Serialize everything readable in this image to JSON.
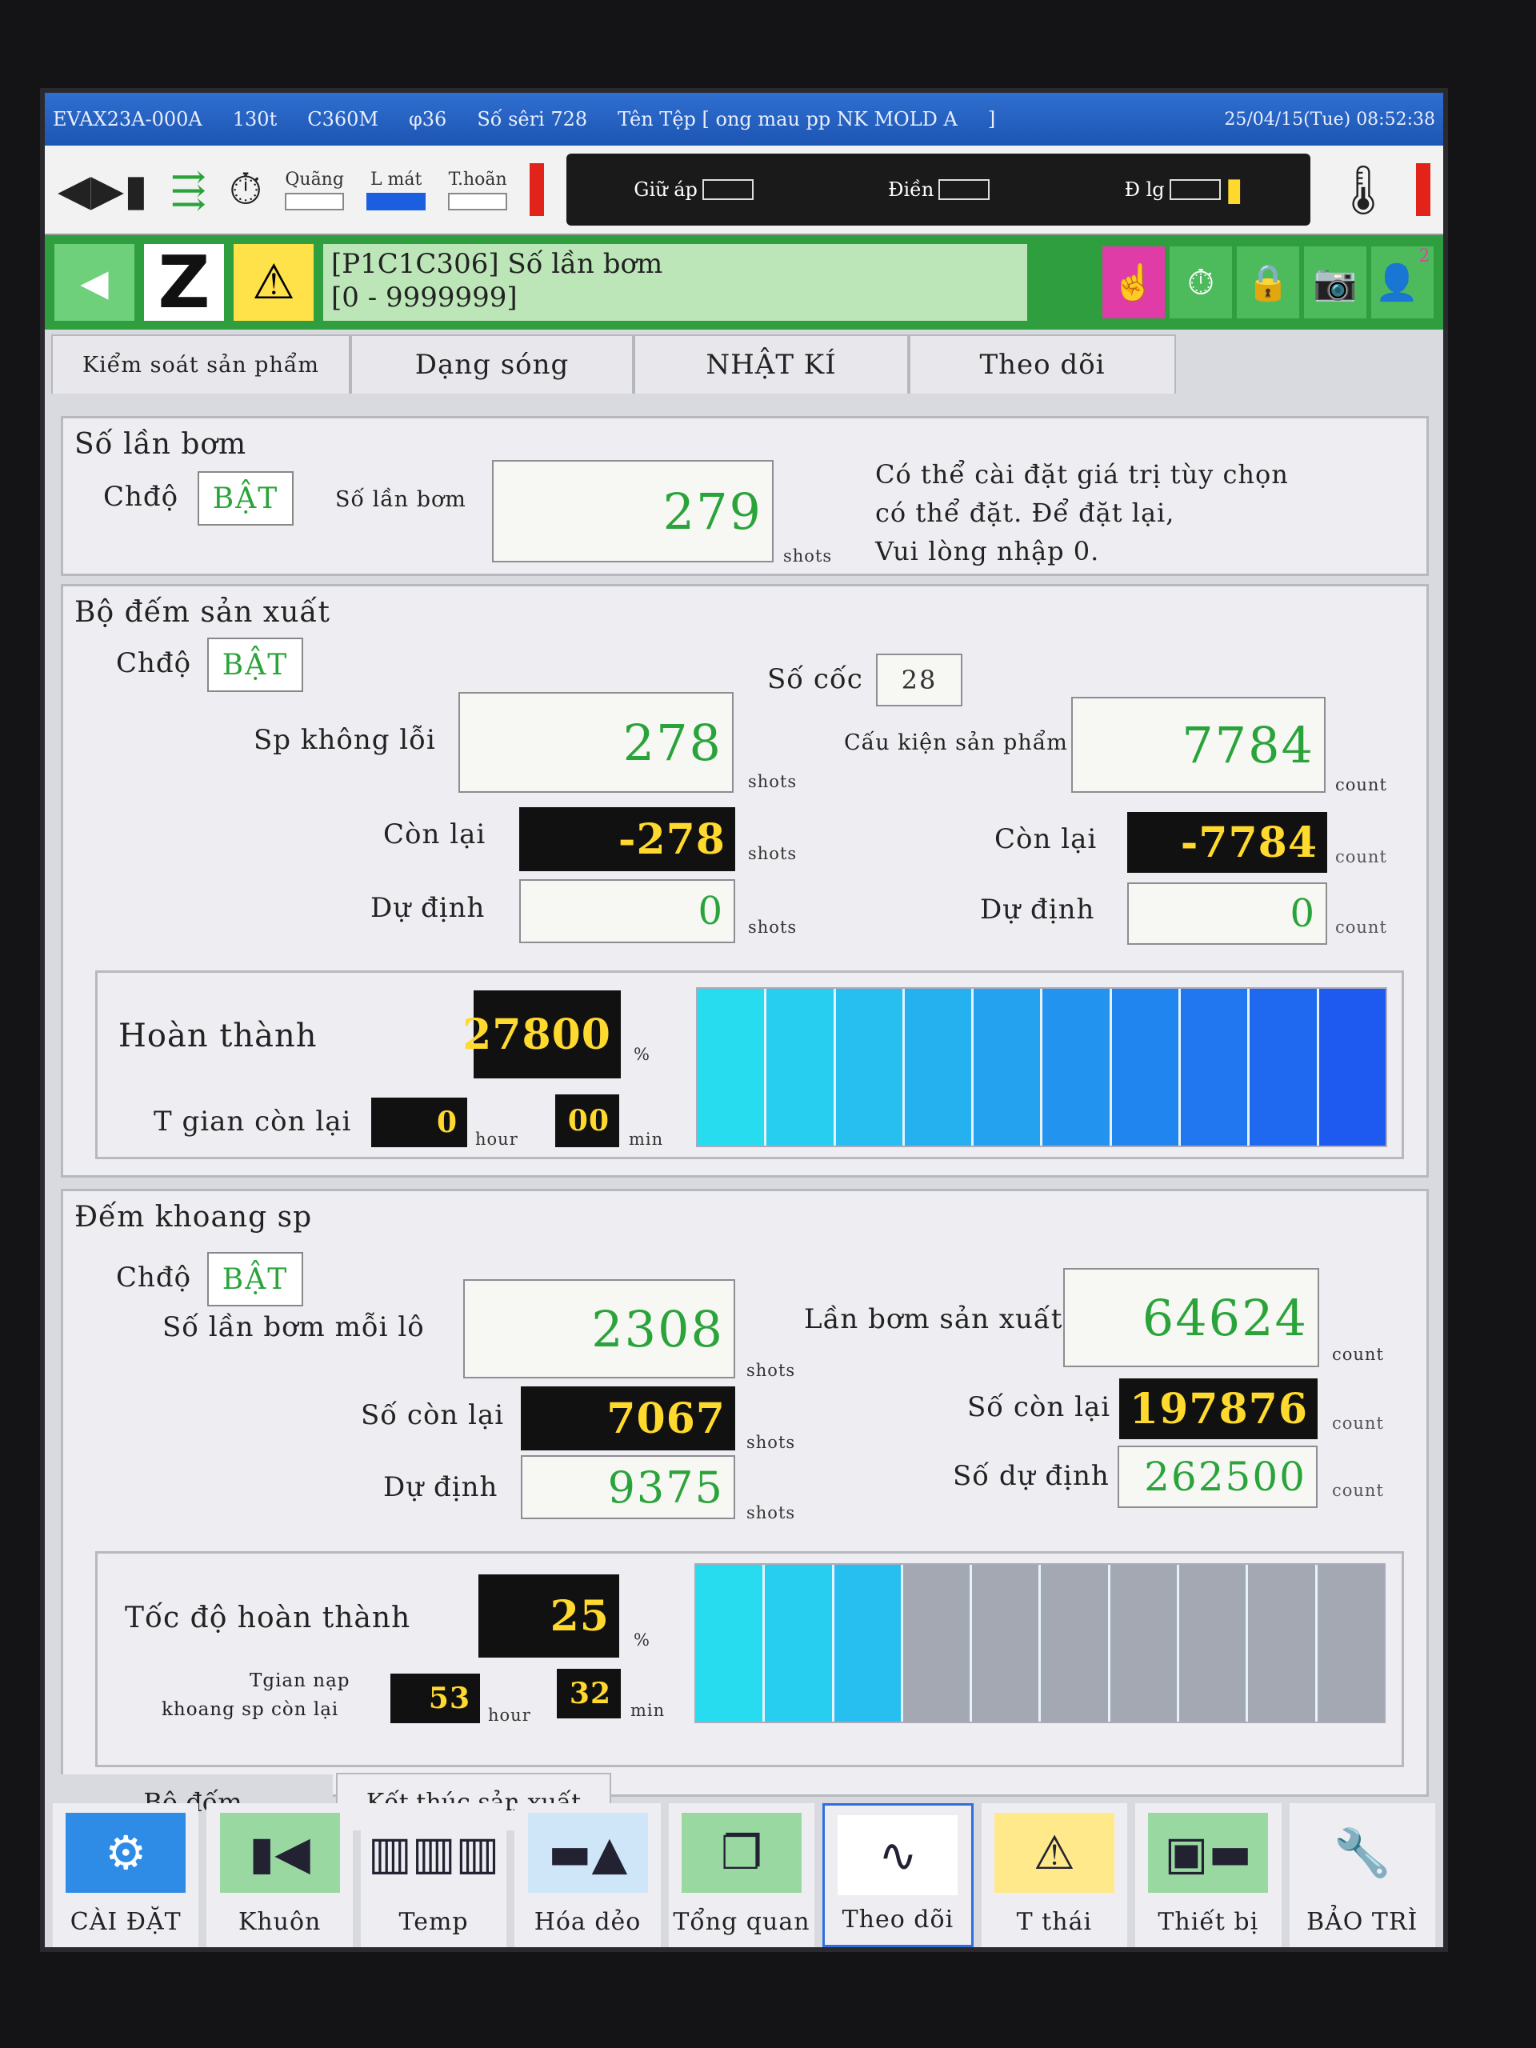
{
  "titlebar": {
    "model": "EVAX23A-000A",
    "ton": "130t",
    "controller": "C360M",
    "screw": "φ36",
    "serial": "Số sêri 728",
    "file": "Tên Tệp [ ong mau pp NK MOLD A",
    "file_end": "]",
    "datetime": "25/04/15(Tue) 08:52:38"
  },
  "iconbar": {
    "quang": "Quãng",
    "l_mat": "L mát",
    "t_hoan": "T.hoãn",
    "giu_ap": "Giữ áp",
    "dien": "Điền",
    "d_lg": "Đ lg"
  },
  "message": {
    "line1": "[P1C1C306] Số lần bơm",
    "line2": "[0 - 9999999]",
    "badge": "2"
  },
  "tabs": [
    "Kiểm soát sản phẩm",
    "Dạng sóng",
    "NHẬT KÍ",
    "Theo dõi"
  ],
  "shot_section": {
    "title": "Số lần bơm",
    "mode_label": "Chđộ",
    "mode_value": "BẬT",
    "shots_label": "Số lần bơm",
    "shots_value": "279",
    "shots_unit": "shots",
    "note_1": "Có thể cài đặt giá trị tùy chọn",
    "note_2": "có thể đặt. Để đặt lại,",
    "note_3": "Vui lòng nhập 0."
  },
  "production_counter": {
    "title": "Bộ đếm sản xuất",
    "mode_label": "Chđộ",
    "mode_value": "BẬT",
    "cavity_label": "Số cốc",
    "cavity_value": "28",
    "good_label": "Sp không lỗi",
    "good_value": "278",
    "good_unit": "shots",
    "parts_label": "Cấu kiện sản phẩm",
    "parts_value": "7784",
    "parts_unit": "count",
    "remain_label": "Còn lại",
    "remain_shots": "-278",
    "remain_shots_unit": "shots",
    "remain_count_label": "Còn lại",
    "remain_count": "-7784",
    "remain_count_unit": "count",
    "plan_label": "Dự định",
    "plan_shots": "0",
    "plan_shots_unit": "shots",
    "plan_count_label": "Dự định",
    "plan_count": "0",
    "plan_count_unit": "count",
    "complete_label": "Hoàn thành",
    "complete_value": "27800",
    "complete_unit": "%",
    "time_label": "T gian còn lại",
    "hours": "0",
    "hour_unit": "hour",
    "mins": "00",
    "min_unit": "min",
    "progress_fraction": 1.0
  },
  "cavity_counter": {
    "title": "Đếm khoang sp",
    "mode_label": "Chđộ",
    "mode_value": "BẬT",
    "per_lot_label": "Số lần bơm mỗi lô",
    "per_lot_value": "2308",
    "per_lot_unit": "shots",
    "prod_shots_label": "Lần bơm sản xuất",
    "prod_shots_value": "64624",
    "prod_shots_unit": "count",
    "remain_label": "Số còn lại",
    "remain_shots": "7067",
    "remain_shots_unit": "shots",
    "remain_count_label": "Số còn lại",
    "remain_count": "197876",
    "remain_count_unit": "count",
    "plan_label": "Dự định",
    "plan_shots": "9375",
    "plan_shots_unit": "shots",
    "plan_count_label": "Số dự định",
    "plan_count": "262500",
    "plan_count_unit": "count",
    "rate_label": "Tốc độ hoàn thành",
    "rate_value": "25",
    "rate_unit": "%",
    "time_label_1": "Tgian nạp",
    "time_label_2": "khoang sp còn lại",
    "hours": "53",
    "hour_unit": "hour",
    "mins": "32",
    "min_unit": "min",
    "progress_fraction": 0.3
  },
  "bottom_tabs": [
    "Bộ đếm",
    "Kết thúc sản xuất"
  ],
  "nav": [
    "CÀI ĐẶT",
    "Khuôn",
    "Temp",
    "Hóa dẻo",
    "Tổng quan",
    "Theo dõi",
    "T thái",
    "Thiết bị",
    "BẢO TRÌ"
  ],
  "colors": {
    "green_value": "#2aa43a",
    "yellow_value": "#ffd92e",
    "accent_green": "#2f9e3e",
    "title_blue": "#1d55b3"
  }
}
